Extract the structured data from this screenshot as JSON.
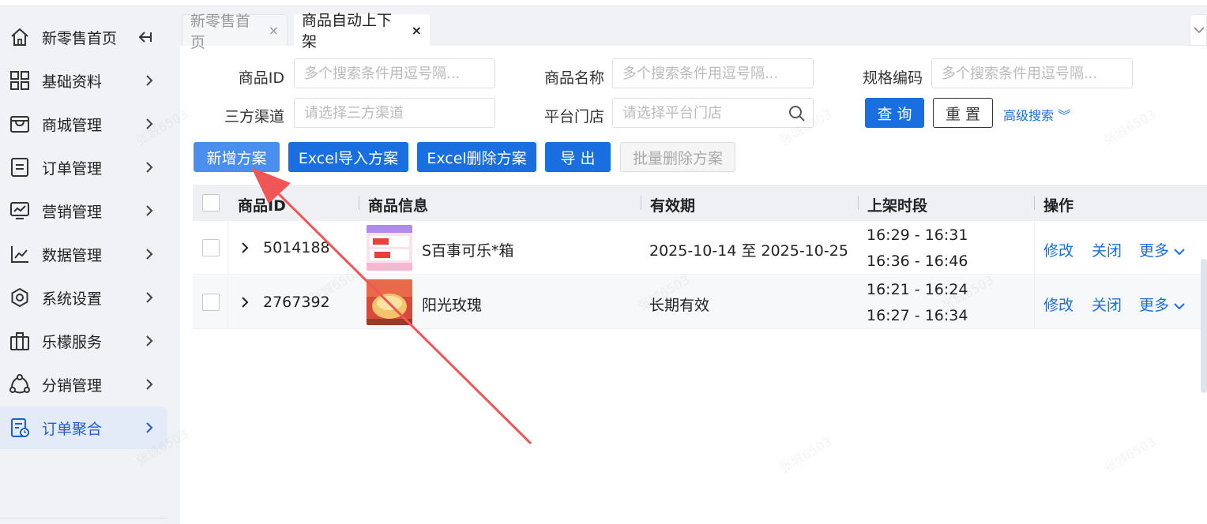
{
  "sidebar": {
    "items": [
      {
        "label": "新零售首页",
        "icon": "home-icon"
      },
      {
        "label": "基础资料",
        "icon": "grid-icon"
      },
      {
        "label": "商城管理",
        "icon": "store-icon"
      },
      {
        "label": "订单管理",
        "icon": "document-icon"
      },
      {
        "label": "营销管理",
        "icon": "monitor-icon"
      },
      {
        "label": "数据管理",
        "icon": "chart-icon"
      },
      {
        "label": "系统设置",
        "icon": "settings-icon"
      },
      {
        "label": "乐檬服务",
        "icon": "bag-icon"
      },
      {
        "label": "分销管理",
        "icon": "share-icon"
      },
      {
        "label": "订单聚合",
        "icon": "order-aggregate-icon"
      }
    ],
    "active_index": 9
  },
  "tabs": [
    {
      "label": "新零售首页",
      "close": "×"
    },
    {
      "label": "商品自动上下架",
      "close": "×"
    }
  ],
  "filters": {
    "product_id_label": "商品ID",
    "product_id_placeholder": "多个搜索条件用逗号隔...",
    "product_name_label": "商品名称",
    "product_name_placeholder": "多个搜索条件用逗号隔...",
    "spec_code_label": "规格编码",
    "spec_code_placeholder": "多个搜索条件用逗号隔...",
    "channel_label": "三方渠道",
    "channel_placeholder": "请选择三方渠道",
    "store_label": "平台门店",
    "store_placeholder": "请选择平台门店",
    "query_button": "查 询",
    "reset_button": "重 置",
    "advanced_search": "高级搜索 ︾"
  },
  "actions": {
    "add": "新增方案",
    "excel_import": "Excel导入方案",
    "excel_delete": "Excel删除方案",
    "export": "导 出",
    "batch_delete": "批量删除方案"
  },
  "table": {
    "headers": {
      "id": "商品ID",
      "info": "商品信息",
      "validity": "有效期",
      "period": "上架时段",
      "ops": "操作"
    },
    "rows": [
      {
        "id": "5014188",
        "name": "S百事可乐*箱",
        "validity": "2025-10-14 至 2025-10-25",
        "period1": "16:29 - 16:31",
        "period2": "16:36 - 16:46"
      },
      {
        "id": "2767392",
        "name": "阳光玫瑰",
        "validity": "长期有效",
        "period1": "16:21 - 16:24",
        "period2": "16:27 - 16:34"
      }
    ],
    "op_edit": "修改",
    "op_close": "关闭",
    "op_more": "更多"
  },
  "watermark": "张城6503",
  "colors": {
    "primary": "#1a6fe0",
    "annotation_arrow": "#f05656"
  }
}
